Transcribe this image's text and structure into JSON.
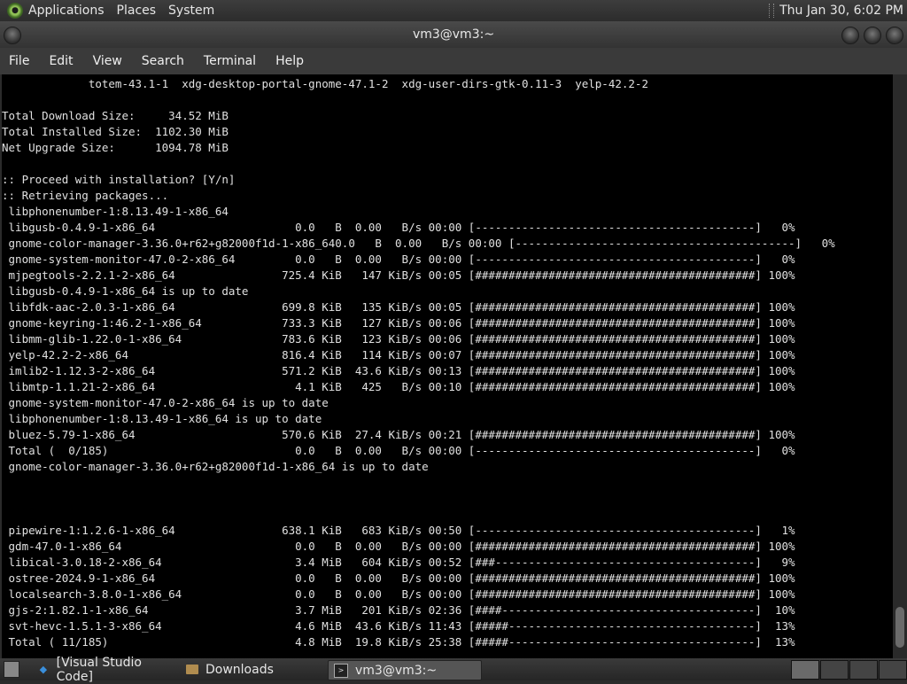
{
  "top_panel": {
    "menus": [
      "Applications",
      "Places",
      "System"
    ],
    "clock": "Thu Jan 30,  6:02 PM"
  },
  "window": {
    "title": "vm3@vm3:~"
  },
  "menubar": [
    "File",
    "Edit",
    "View",
    "Search",
    "Terminal",
    "Help"
  ],
  "terminal": {
    "lines": [
      "             totem-43.1-1  xdg-desktop-portal-gnome-47.1-2  xdg-user-dirs-gtk-0.11-3  yelp-42.2-2",
      "",
      "Total Download Size:     34.52 MiB",
      "Total Installed Size:  1102.30 MiB",
      "Net Upgrade Size:      1094.78 MiB",
      "",
      ":: Proceed with installation? [Y/n]",
      ":: Retrieving packages...",
      " libphonenumber-1:8.13.49-1-x86_64",
      " libgusb-0.4.9-1-x86_64                     0.0   B  0.00   B/s 00:00 [------------------------------------------]   0%",
      " gnome-color-manager-3.36.0+r62+g82000f1d-1-x86_640.0   B  0.00   B/s 00:00 [------------------------------------------]   0%",
      " gnome-system-monitor-47.0-2-x86_64         0.0   B  0.00   B/s 00:00 [------------------------------------------]   0%",
      " mjpegtools-2.2.1-2-x86_64                725.4 KiB   147 KiB/s 00:05 [##########################################] 100%",
      " libgusb-0.4.9-1-x86_64 is up to date",
      " libfdk-aac-2.0.3-1-x86_64                699.8 KiB   135 KiB/s 00:05 [##########################################] 100%",
      " gnome-keyring-1:46.2-1-x86_64            733.3 KiB   127 KiB/s 00:06 [##########################################] 100%",
      " libmm-glib-1.22.0-1-x86_64               783.6 KiB   123 KiB/s 00:06 [##########################################] 100%",
      " yelp-42.2-2-x86_64                       816.4 KiB   114 KiB/s 00:07 [##########################################] 100%",
      " imlib2-1.12.3-2-x86_64                   571.2 KiB  43.6 KiB/s 00:13 [##########################################] 100%",
      " libmtp-1.1.21-2-x86_64                     4.1 KiB   425   B/s 00:10 [##########################################] 100%",
      " gnome-system-monitor-47.0-2-x86_64 is up to date",
      " libphonenumber-1:8.13.49-1-x86_64 is up to date",
      " bluez-5.79-1-x86_64                      570.6 KiB  27.4 KiB/s 00:21 [##########################################] 100%",
      " Total (  0/185)                            0.0   B  0.00   B/s 00:00 [------------------------------------------]   0%",
      " gnome-color-manager-3.36.0+r62+g82000f1d-1-x86_64 is up to date",
      "",
      "",
      "",
      " pipewire-1:1.2.6-1-x86_64                638.1 KiB   683 KiB/s 00:50 [------------------------------------------]   1%",
      " gdm-47.0-1-x86_64                          0.0   B  0.00   B/s 00:00 [##########################################] 100%",
      " libical-3.0.18-2-x86_64                    3.4 MiB   604 KiB/s 00:52 [###---------------------------------------]   9%",
      " ostree-2024.9-1-x86_64                     0.0   B  0.00   B/s 00:00 [##########################################] 100%",
      " localsearch-3.8.0-1-x86_64                 0.0   B  0.00   B/s 00:00 [##########################################] 100%",
      " gjs-2:1.82.1-1-x86_64                      3.7 MiB   201 KiB/s 02:36 [####--------------------------------------]  10%",
      " svt-hevc-1.5.1-3-x86_64                    4.6 MiB  43.6 KiB/s 11:43 [#####-------------------------------------]  13%",
      " Total ( 11/185)                            4.8 MiB  19.8 KiB/s 25:38 [#####-------------------------------------]  13%"
    ]
  },
  "taskbar": {
    "tasks": [
      {
        "label": "[Visual Studio Code]",
        "icon": "vscode-icon"
      },
      {
        "label": "Downloads",
        "icon": "folder-icon"
      },
      {
        "label": "vm3@vm3:~",
        "icon": "terminal-icon"
      }
    ]
  },
  "colors": {
    "panel_bg": "#333333",
    "terminal_bg": "#000000",
    "terminal_fg": "#e0e0e0"
  }
}
